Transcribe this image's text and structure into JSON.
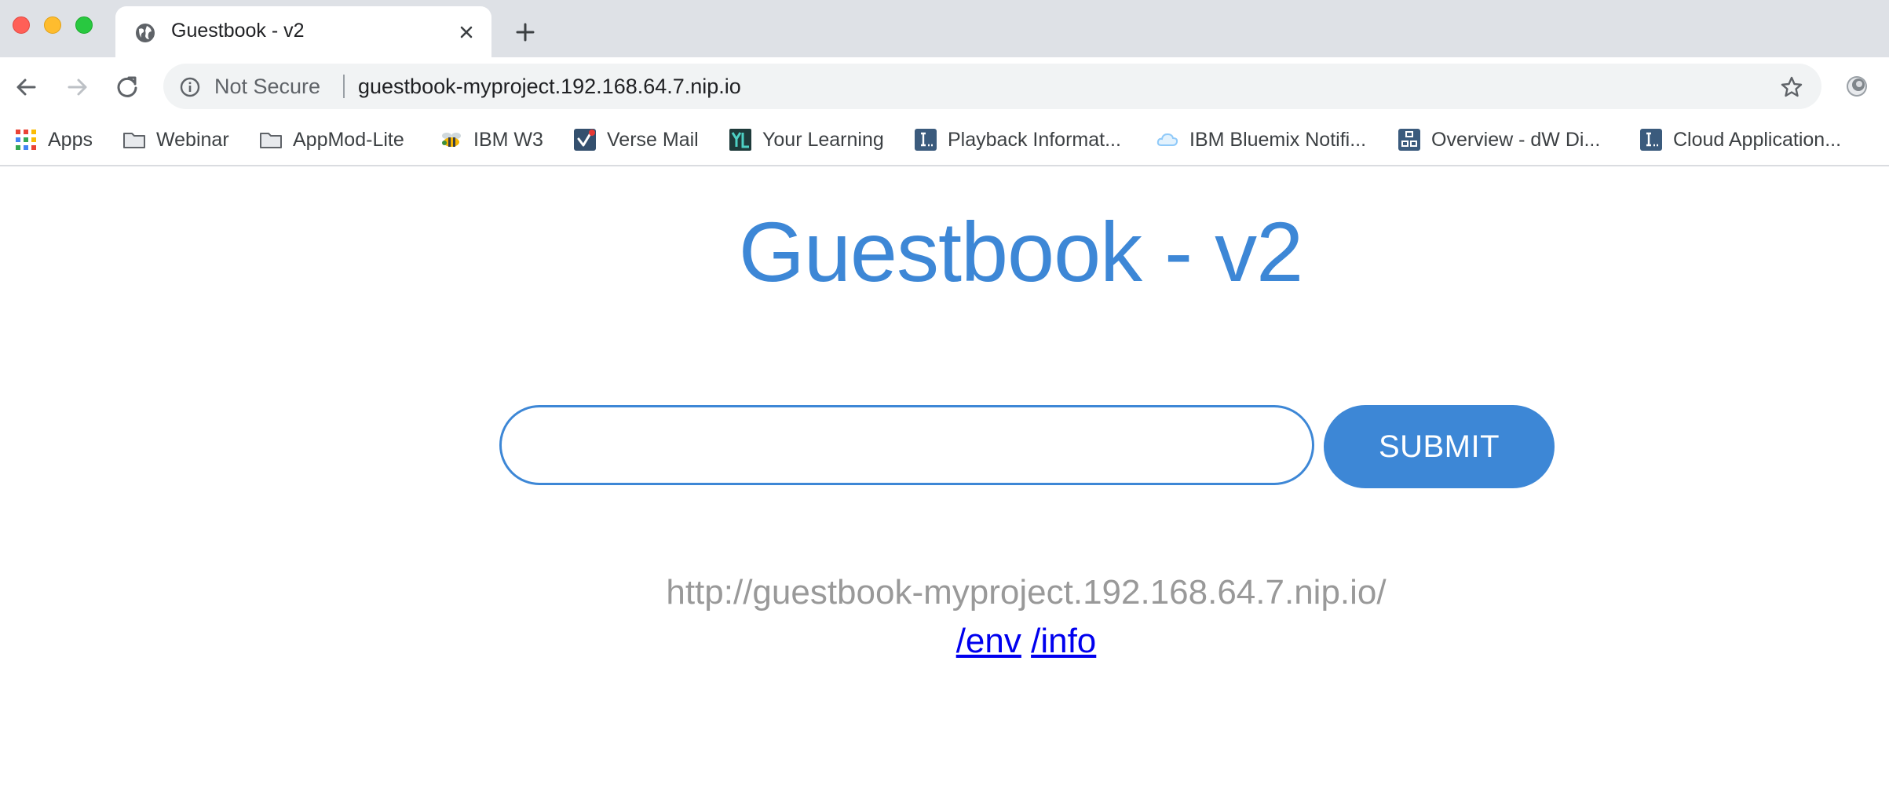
{
  "browser": {
    "tab": {
      "title": "Guestbook - v2",
      "favicon": "globe-icon"
    },
    "omnibox": {
      "security_label": "Not Secure",
      "url": "guestbook-myproject.192.168.64.7.nip.io"
    },
    "bookmarks": [
      {
        "label": "Apps",
        "icon": "apps-grid-icon"
      },
      {
        "label": "Webinar",
        "icon": "folder-icon"
      },
      {
        "label": "AppMod-Lite",
        "icon": "folder-icon"
      },
      {
        "label": "IBM W3",
        "icon": "bee-icon"
      },
      {
        "label": "Verse Mail",
        "icon": "verse-icon"
      },
      {
        "label": "Your Learning",
        "icon": "yl-icon"
      },
      {
        "label": "Playback Informat...",
        "icon": "ibm-doc-icon"
      },
      {
        "label": "IBM Bluemix Notifi...",
        "icon": "cloud-icon"
      },
      {
        "label": "Overview - dW Di...",
        "icon": "dw-icon"
      },
      {
        "label": "Cloud Application...",
        "icon": "ibm-doc-icon"
      }
    ]
  },
  "page": {
    "title": "Guestbook - v2",
    "input": {
      "value": "",
      "placeholder": ""
    },
    "submit_label": "SUBMIT",
    "host_url": "http://guestbook-myproject.192.168.64.7.nip.io/",
    "links": [
      {
        "label": "/env"
      },
      {
        "label": "/info"
      }
    ]
  },
  "colors": {
    "accent": "#3d87d6",
    "tabstrip": "#dee1e6",
    "link": "#0000ee",
    "host_text": "#999999"
  }
}
